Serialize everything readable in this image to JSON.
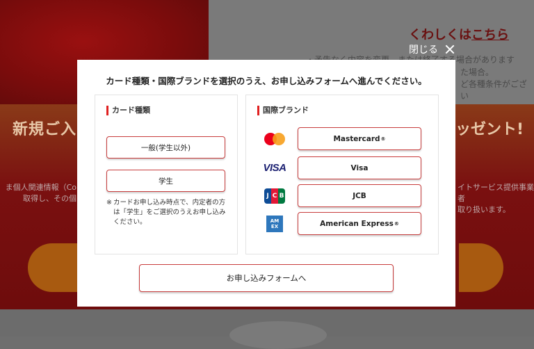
{
  "background": {
    "link_prefix": "くわしくは",
    "link_text": "こちら",
    "note_line1": "・予告なく内容を変更、または終了する場合があります",
    "note_line2": "た場合。",
    "note_line3": "ど各種条件がござい",
    "banner_left": "新規ご入",
    "banner_right": "ッゼント!",
    "small_left_line1": "ま個人関連情報（Co",
    "small_left_line2": "取得し、その個",
    "small_right_line1": "イトサービス提供事業者",
    "small_right_line2": "取り扱います。"
  },
  "close": {
    "label": "閉じる"
  },
  "modal": {
    "heading": "カード種類・国際ブランドを選択のうえ、お申し込みフォームへ進んでください。",
    "card_type": {
      "title": "カード種類",
      "options": [
        "一般(学生以外)",
        "学生"
      ],
      "note_mark": "※",
      "note": "カードお申し込み時点で、内定者の方は「学生」をご選択のうえお申し込みください。"
    },
    "brand": {
      "title": "国際ブランド",
      "options": [
        {
          "label": "Mastercard",
          "sup": "®",
          "icon": "mastercard-logo"
        },
        {
          "label": "Visa",
          "sup": "",
          "icon": "visa-logo"
        },
        {
          "label": "JCB",
          "sup": "",
          "icon": "jcb-logo"
        },
        {
          "label": "American Express",
          "sup": "®",
          "icon": "amex-logo"
        }
      ],
      "logos": {
        "visa": "VISA",
        "jcb": [
          "J",
          "C",
          "B"
        ],
        "amex": [
          "AM",
          "EX"
        ]
      }
    },
    "submit_label": "お申し込みフォームへ"
  },
  "colors": {
    "accent": "#e02020",
    "button_border": "#c73b3b",
    "overlay": "#6e6e6e"
  }
}
